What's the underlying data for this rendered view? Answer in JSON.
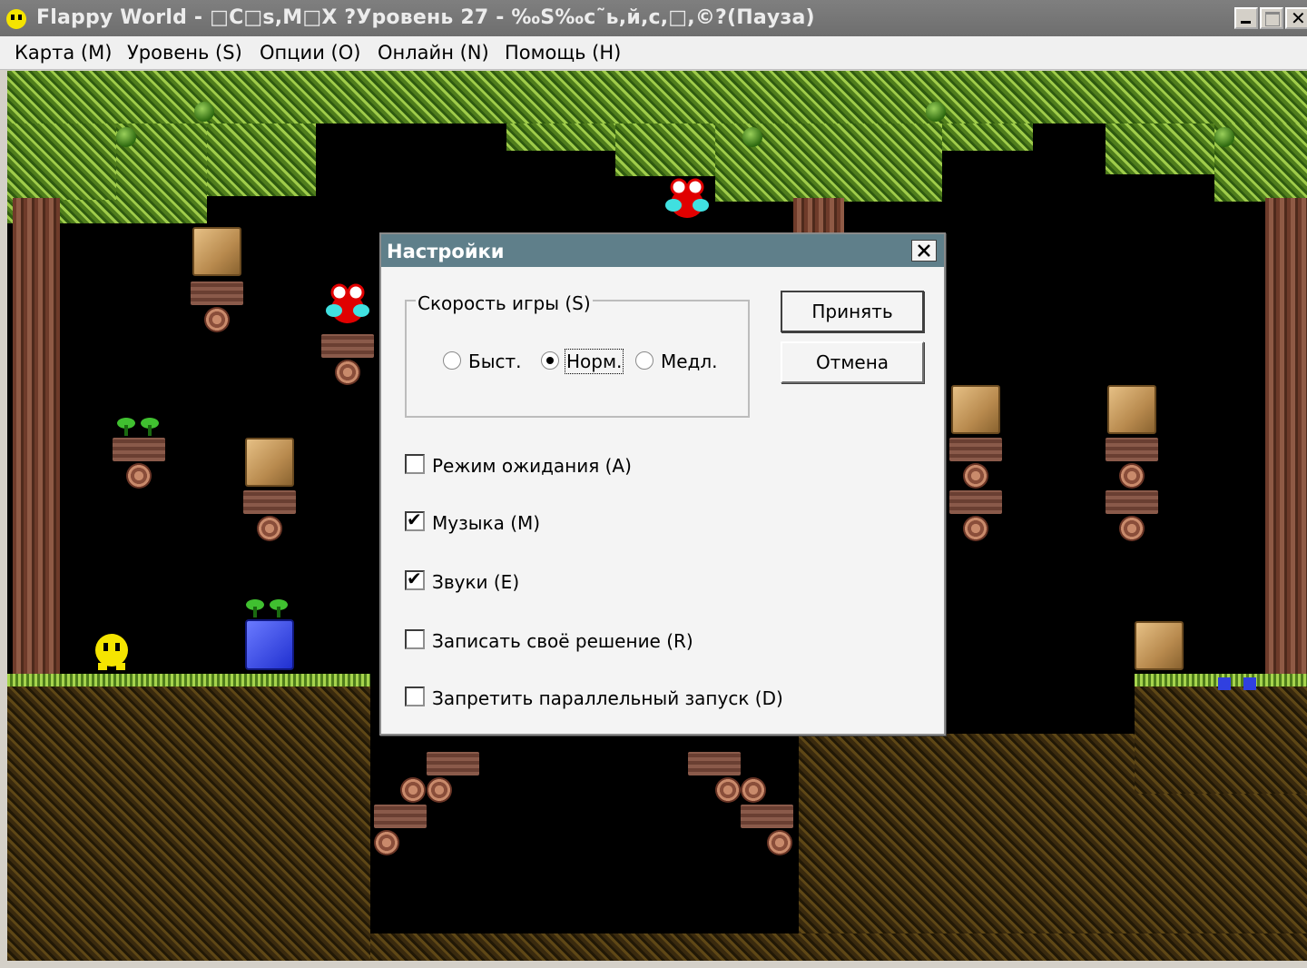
{
  "window": {
    "title": "Flappy World - □C□s,M□X ?Уровень 27 - ‰S‰c˜ь,й,с,□,©?(Пауза)"
  },
  "menu": {
    "items": [
      {
        "label": "Карта (M)"
      },
      {
        "label": "Уровень (S)"
      },
      {
        "label": "Опции (O)"
      },
      {
        "label": "Онлайн (N)"
      },
      {
        "label": "Помощь (H)"
      }
    ]
  },
  "dialog": {
    "title": "Настройки",
    "speed_group": {
      "label": "Скорость игры (S)",
      "options": [
        "Быст.",
        "Норм.",
        "Медл."
      ],
      "selected": "Норм."
    },
    "checkboxes": [
      {
        "label": "Режим ожидания (A)",
        "checked": false
      },
      {
        "label": "Музыка (M)",
        "checked": true
      },
      {
        "label": "Звуки (E)",
        "checked": true
      },
      {
        "label": "Записать своё решение (R)",
        "checked": false
      },
      {
        "label": "Запретить параллельный запуск (D)",
        "checked": false
      }
    ],
    "ok_label": "Принять",
    "cancel_label": "Отмена"
  },
  "icons": {
    "app": "flappy-face-icon",
    "minimize": "minimize-icon",
    "maximize": "maximize-icon",
    "close": "close-icon"
  },
  "colors": {
    "titlebar": "#6e6e6e",
    "dialog_title": "#5f7f8a",
    "game_background": "#000000"
  }
}
